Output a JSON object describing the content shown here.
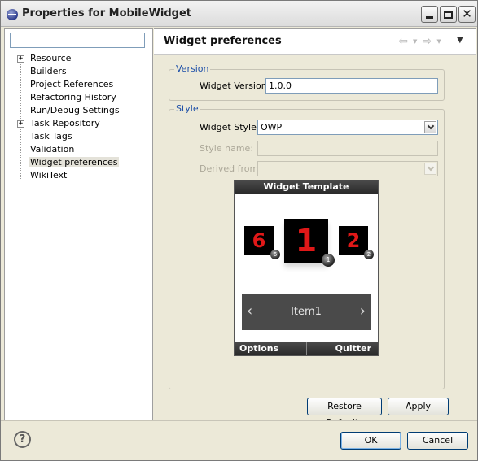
{
  "window": {
    "title": "Properties for MobileWidget"
  },
  "tree": {
    "filter_value": "",
    "items": [
      {
        "label": "Resource",
        "expandable": true
      },
      {
        "label": "Builders",
        "expandable": false
      },
      {
        "label": "Project References",
        "expandable": false
      },
      {
        "label": "Refactoring History",
        "expandable": false
      },
      {
        "label": "Run/Debug Settings",
        "expandable": false
      },
      {
        "label": "Task Repository",
        "expandable": true
      },
      {
        "label": "Task Tags",
        "expandable": false
      },
      {
        "label": "Validation",
        "expandable": false
      },
      {
        "label": "Widget preferences",
        "expandable": false,
        "selected": true
      },
      {
        "label": "WikiText",
        "expandable": false
      }
    ]
  },
  "page": {
    "title": "Widget preferences"
  },
  "version_group": {
    "label": "Version",
    "widget_version_label": "Widget Version:",
    "widget_version_value": "1.0.0"
  },
  "style_group": {
    "label": "Style",
    "widget_style_label": "Widget Style:",
    "widget_style_value": "OWP",
    "style_name_label": "Style name:",
    "style_name_value": "",
    "derived_from_label": "Derived from:",
    "derived_from_value": ""
  },
  "preview": {
    "title": "Widget Template",
    "tiles": [
      {
        "text": "6",
        "badge": "6"
      },
      {
        "text": "1",
        "badge": "1"
      },
      {
        "text": "2",
        "badge": "2"
      }
    ],
    "item_label": "Item1",
    "left_softkey": "Options",
    "right_softkey": "Quitter"
  },
  "buttons": {
    "restore_defaults": "Restore Defaults",
    "apply": "Apply",
    "ok": "OK",
    "cancel": "Cancel"
  },
  "icons": {
    "help": "?",
    "back": "⇦",
    "forward": "⇨",
    "view_menu": "▼"
  },
  "colors": {
    "group_label": "#1d4fa8",
    "tile_text": "#e01818",
    "selection_bg": "#e4e2d9"
  }
}
